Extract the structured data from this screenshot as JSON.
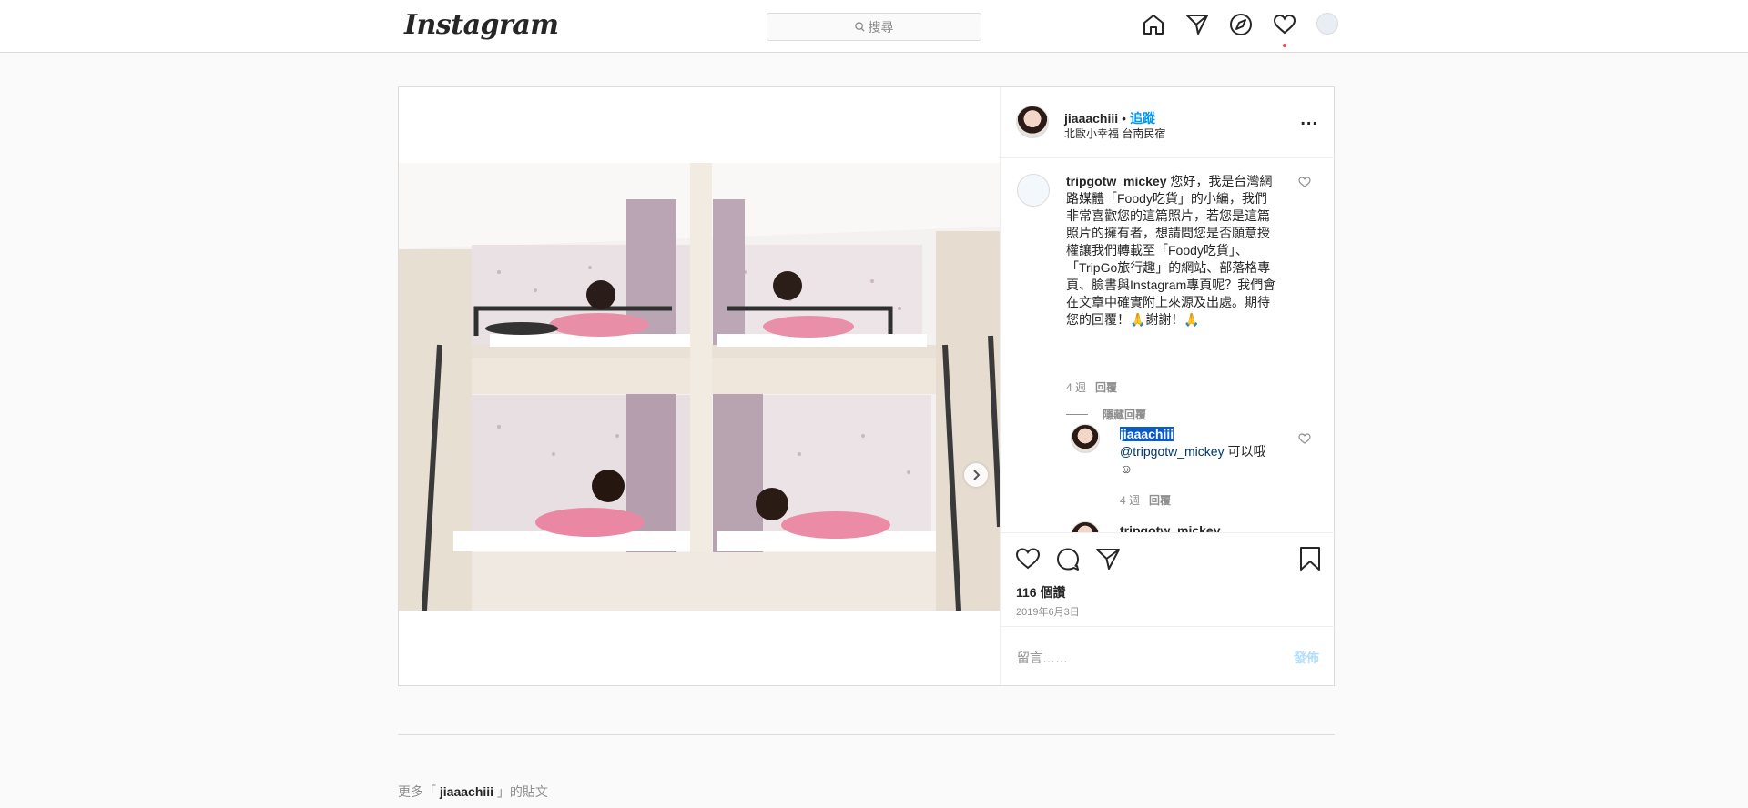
{
  "topbar": {
    "logo": "Instagram",
    "search_placeholder": "搜尋"
  },
  "post": {
    "username": "jiaaachiii",
    "separator": "•",
    "follow_label": "追蹤",
    "location": "北歐小幸福 台南民宿",
    "more_label": "...",
    "comment1": {
      "username": "tripgotw_mickey",
      "text": " 您好，我是台灣網路媒體「Foody吃貨」的小編，我們非常喜歡您的這篇照片，若您是這篇照片的擁有者，想請問您是否願意授權讓我們轉載至「Foody吃貨」、「TripGo旅行趣」的網站、部落格專頁、臉書與Instagram專頁呢？我們會在文章中確實附上來源及出處。期待您的回覆！🙏謝謝！🙏",
      "age": "4 週",
      "reply_label": "回覆"
    },
    "hide_replies": "隱藏回覆",
    "reply1": {
      "username": "jiaaachiii",
      "mention": "@tripgotw_mickey",
      "text": " 可以哦☺",
      "age": "4 週",
      "reply_label": "回覆"
    },
    "partial_username": "tripgotw_mickey",
    "likes": "116 個讚",
    "date": "2019年6月3日",
    "comment_placeholder": "留言……",
    "post_button": "發佈"
  },
  "more_posts": {
    "prefix": "更多「 ",
    "username": "jiaaachiii",
    "suffix": " 」的貼文"
  },
  "colors": {
    "link_blue": "#0095f6",
    "notification_red": "#ed4956",
    "border": "#dbdbdb"
  }
}
